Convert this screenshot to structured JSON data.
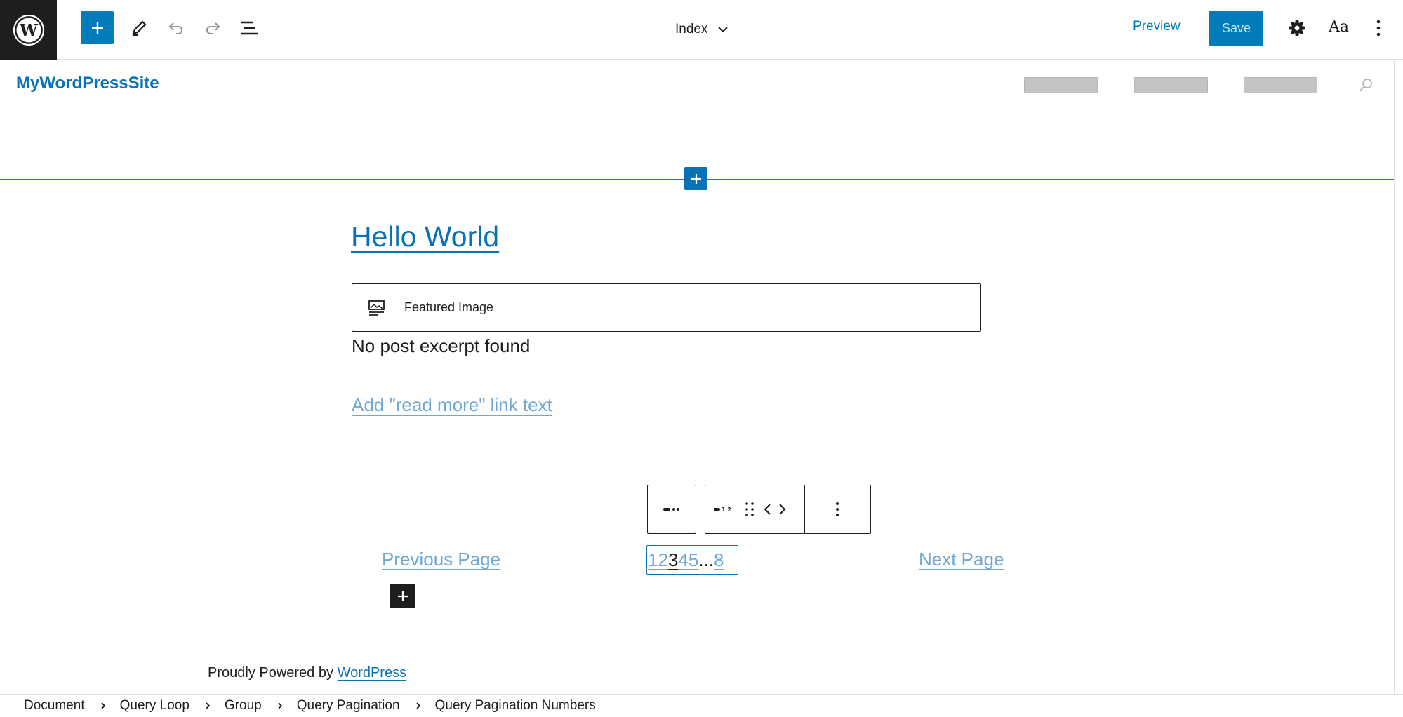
{
  "toolbar": {
    "document_title": "Index",
    "preview_label": "Preview",
    "save_label": "Save",
    "styles_label": "Aa"
  },
  "site": {
    "title": "MyWordPressSite",
    "nav_placeholders": 3
  },
  "post": {
    "title": "Hello World",
    "featured_image_label": "Featured Image",
    "excerpt": "No post excerpt found",
    "read_more_placeholder": "Add \"read more\" link text"
  },
  "pagination": {
    "previous_label": "Previous Page",
    "next_label": "Next Page",
    "numbers": [
      "1",
      "2",
      "3",
      "4",
      "5",
      "...",
      "8"
    ],
    "current": "3"
  },
  "footer": {
    "text": "Proudly Powered by ",
    "link": "WordPress"
  },
  "breadcrumb": {
    "items": [
      "Document",
      "Query Loop",
      "Group",
      "Query Pagination",
      "Query Pagination Numbers"
    ]
  },
  "colors": {
    "accent": "#007cba",
    "link": "#0a72b4",
    "placeholder_link": "#6fa8d6",
    "dark": "#1e1e1e"
  }
}
